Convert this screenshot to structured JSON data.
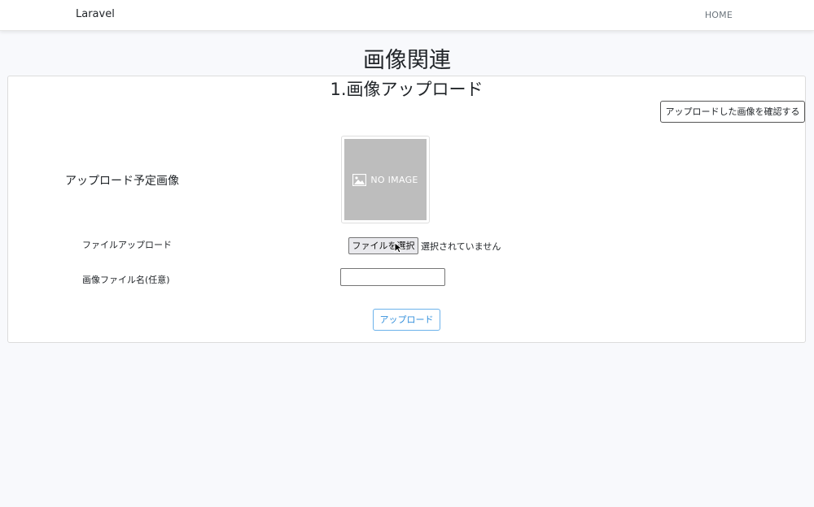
{
  "navbar": {
    "brand": "Laravel",
    "home_link": "HOME"
  },
  "page": {
    "title": "画像関連"
  },
  "card": {
    "title": "1.画像アップロード",
    "confirm_button": "アップロードした画像を確認する",
    "preview_label": "アップロード予定画像",
    "preview_placeholder": {
      "icon": "image-icon",
      "text": "NO IMAGE"
    },
    "file_label": "ファイルアップロード",
    "file_button": "ファイルを選択",
    "file_status": "選択されていません",
    "name_label": "画像ファイル名(任意)",
    "name_value": "",
    "upload_button": "アップロード"
  },
  "colors": {
    "background": "#f8f9fc",
    "placeholder_gray": "#bdbdbd",
    "upload_accent": "#3490dc"
  }
}
